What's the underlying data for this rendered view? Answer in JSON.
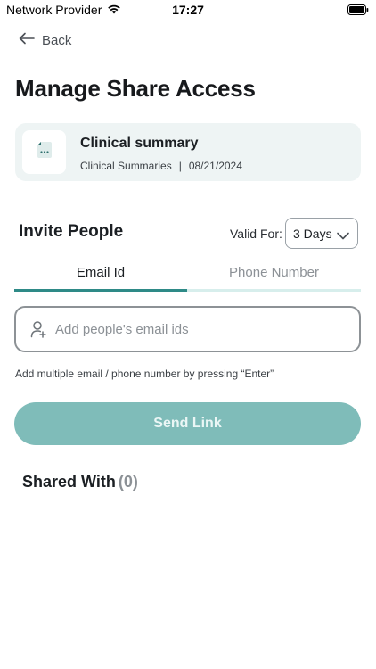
{
  "status_bar": {
    "carrier": "Network Provider",
    "time": "17:27",
    "wifi_icon": "wifi-icon",
    "battery_icon": "battery-icon"
  },
  "nav": {
    "back_label": "Back",
    "back_icon": "arrow-left-icon"
  },
  "page": {
    "title": "Manage Share Access"
  },
  "document": {
    "name": "Clinical summary",
    "category": "Clinical Summaries",
    "separator": "|",
    "date": "08/21/2024",
    "icon": "document-icon"
  },
  "invite": {
    "title": "Invite People",
    "valid_for_label": "Valid For:",
    "valid_for_value": "3 Days",
    "tabs": [
      {
        "label": "Email Id",
        "active": true
      },
      {
        "label": "Phone Number",
        "active": false
      }
    ],
    "input_placeholder": "Add people's email ids",
    "input_value": "",
    "input_icon": "add-user-icon",
    "hint": "Add multiple email / phone number by pressing “Enter”",
    "send_label": "Send Link"
  },
  "shared": {
    "title": "Shared With",
    "count": "(0)"
  },
  "colors": {
    "accent": "#2e8a87",
    "button_bg": "#7fbcb9",
    "card_bg": "#eef4f4"
  }
}
